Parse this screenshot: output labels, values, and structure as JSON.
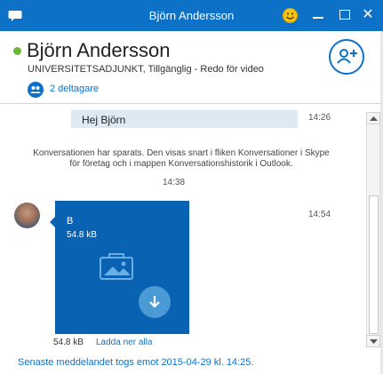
{
  "window": {
    "title": "Björn Andersson"
  },
  "header": {
    "name": "Björn Andersson",
    "subtitle": "UNIVERSITETSADJUNKT,  Tillgänglig - Redo för video",
    "participants": "2 deltagare"
  },
  "conversation": {
    "message_text": "Hej Björn",
    "message_time": "14:26",
    "notice_line1": "Konversationen har sparats. Den visas snart i fliken Konversationer i Skype",
    "notice_line2": "för företag och i mappen Konversationshistorik i Outlook.",
    "notice_time": "14:38",
    "file_time": "14:54",
    "file_name": "B",
    "file_size": "54.8 kB",
    "below_size": "54.8 kB",
    "download_all": "Ladda ner alla",
    "last_message": "Senaste meddelandet togs emot 2015-04-29 kl. 14:25."
  },
  "colors": {
    "accent": "#0d72c7",
    "status_available": "#6bb536",
    "file_card": "#0a62b3",
    "bubble": "#dde9f3"
  },
  "icons": [
    "chat-icon",
    "emoji-icon",
    "minimize-icon",
    "maximize-icon",
    "close-icon",
    "participants-icon",
    "add-person-icon",
    "image-icon",
    "download-icon"
  ]
}
